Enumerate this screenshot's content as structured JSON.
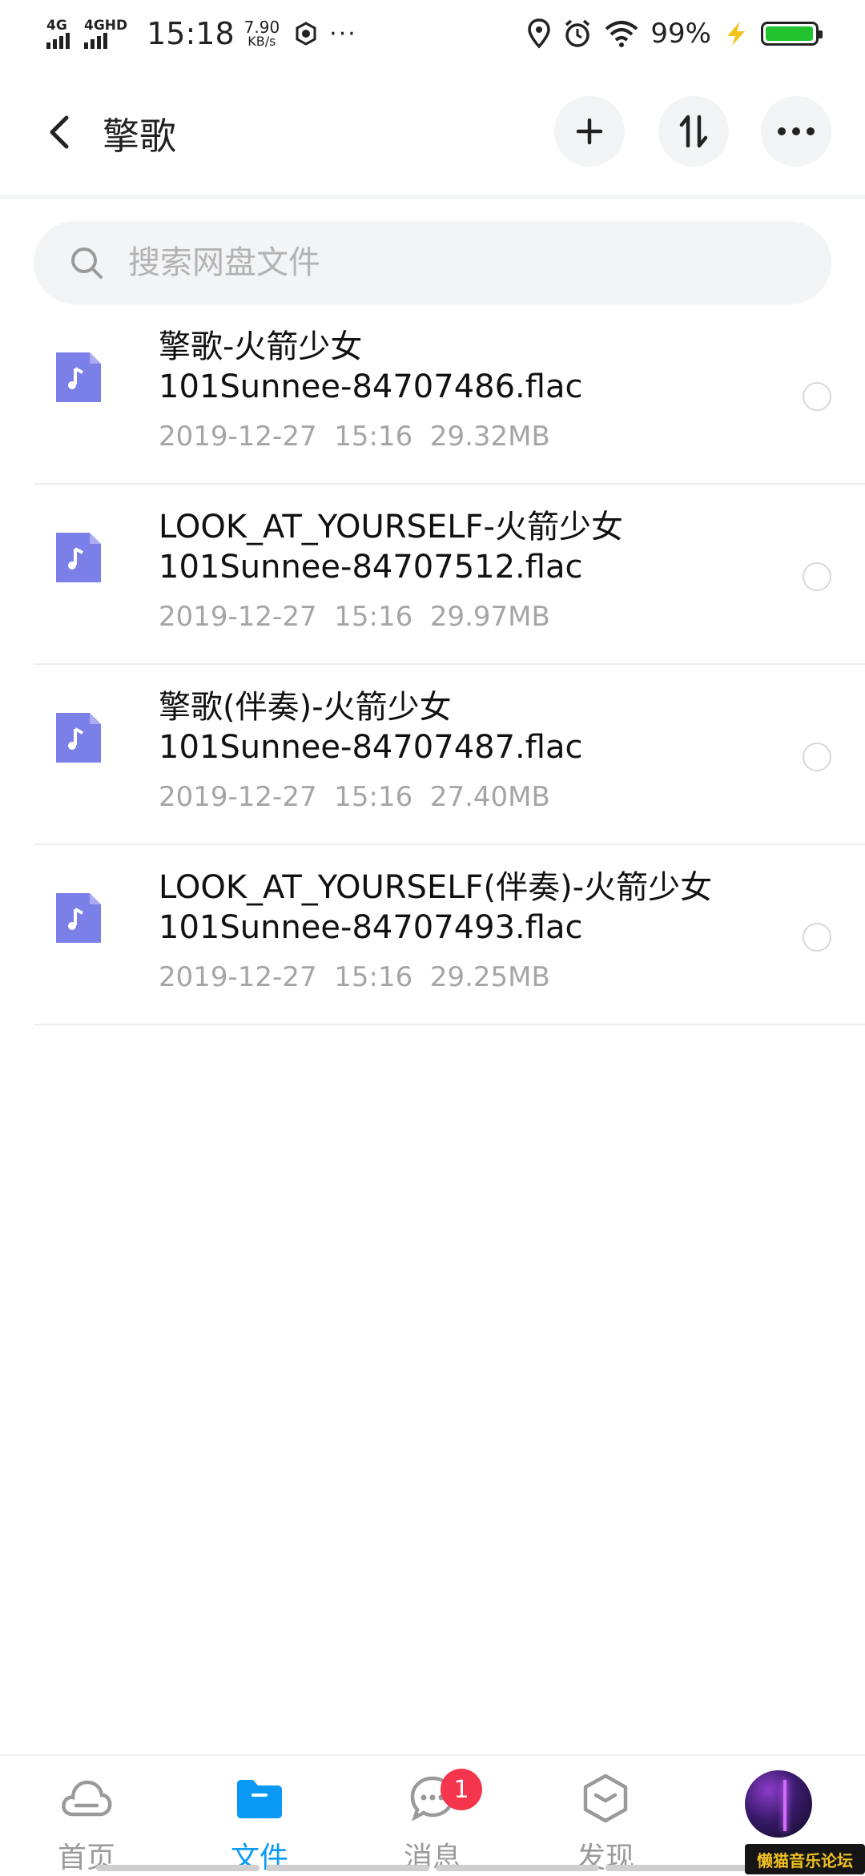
{
  "status_bar": {
    "net1": "4G",
    "net2": "4GHD",
    "time": "15:18",
    "speed_value": "7.90",
    "speed_unit": "KB/s",
    "more": "···",
    "battery_percent": "99%",
    "battery_level": 0.99,
    "battery_color": "#22c32e"
  },
  "header": {
    "title": "擎歌",
    "back_icon": "chevron-left-icon",
    "add_icon": "plus-icon",
    "sort_icon": "sort-icon",
    "more_icon": "more-horizontal-icon"
  },
  "search": {
    "placeholder": "搜索网盘文件",
    "value": ""
  },
  "files": [
    {
      "name_line1": "擎歌-火箭少女",
      "name_line2": "101Sunnee-84707486.flac",
      "date": "2019-12-27",
      "time": "15:16",
      "size": "29.32MB"
    },
    {
      "name_line1": "LOOK_AT_YOURSELF-火箭少女",
      "name_line2": "101Sunnee-84707512.flac",
      "date": "2019-12-27",
      "time": "15:16",
      "size": "29.97MB"
    },
    {
      "name_line1": "擎歌(伴奏)-火箭少女",
      "name_line2": "101Sunnee-84707487.flac",
      "date": "2019-12-27",
      "time": "15:16",
      "size": "27.40MB"
    },
    {
      "name_line1": "LOOK_AT_YOURSELF(伴奏)-火箭少女",
      "name_line2": "101Sunnee-84707493.flac",
      "date": "2019-12-27",
      "time": "15:16",
      "size": "29.25MB"
    }
  ],
  "file_icon": "music-file-icon",
  "file_icon_color": "#7b80e8",
  "bottom_nav": {
    "home": "首页",
    "files": "文件",
    "messages": "消息",
    "messages_badge": "1",
    "discover": "发现"
  },
  "accent_color": "#0a99f5",
  "badge_color": "#f4354b",
  "watermark": "懒猫音乐论坛"
}
